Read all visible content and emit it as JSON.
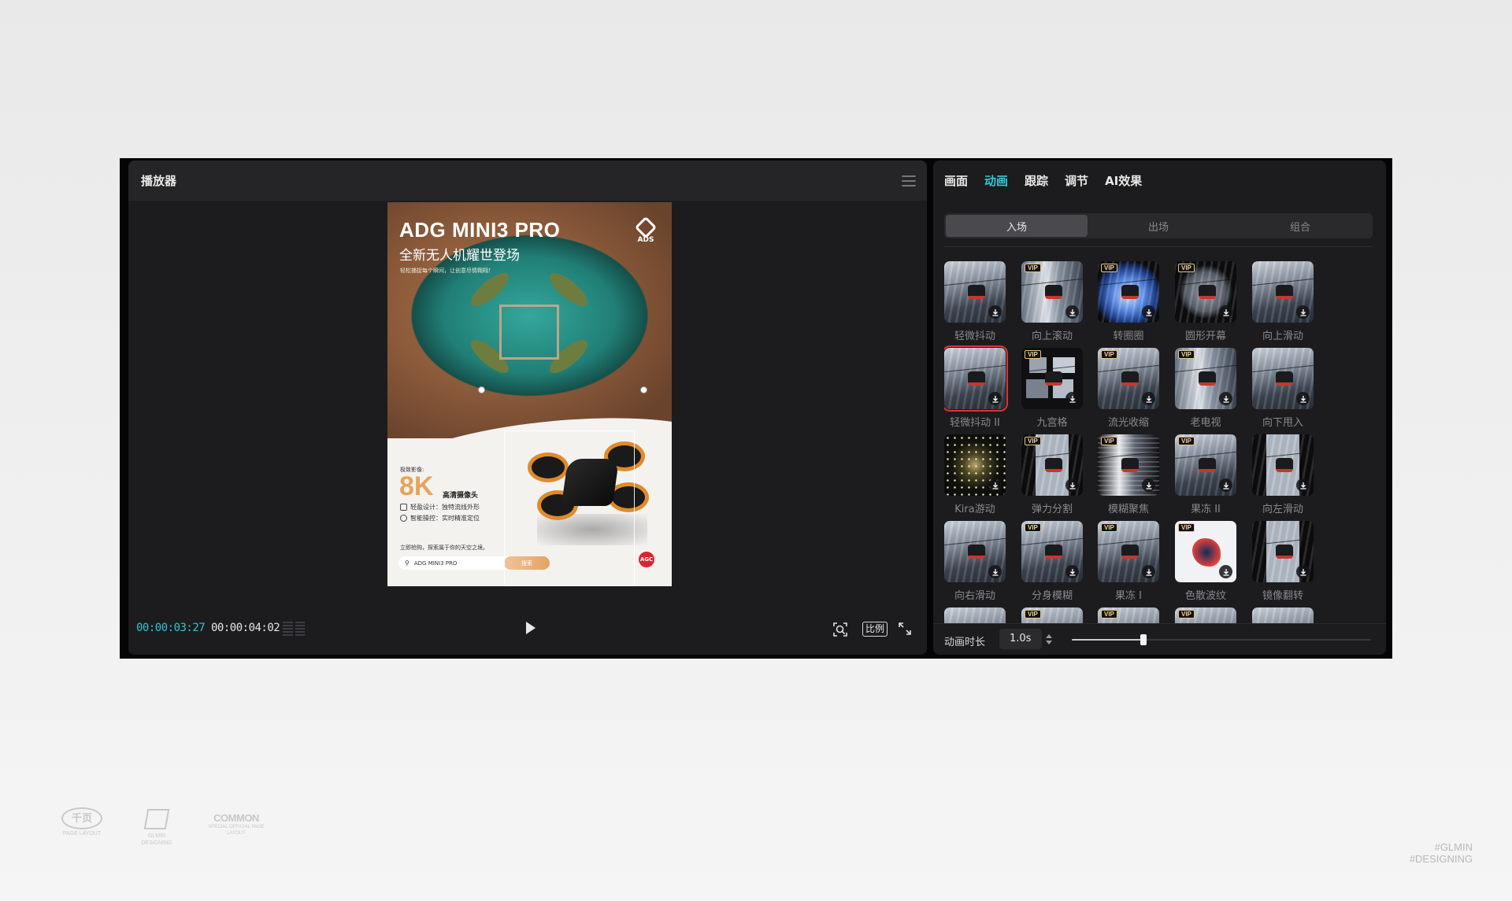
{
  "player": {
    "title": "播放器",
    "time_current": "00:00:03:27",
    "time_total": "00:00:04:02",
    "ratio_label": "比例"
  },
  "poster": {
    "headline": "ADG MINI3 PRO",
    "subheadline": "全新无人机耀世登场",
    "tagline": "轻松捕捉每个瞬间，让创意尽情翱翔！",
    "logo": "ADS",
    "label_imaging": "极致影像:",
    "big": "8K",
    "camera": "高清摄像头",
    "feature_1": "轻盈设计：独特流线外形",
    "feature_2": "智能操控：实时精准定位",
    "cta": "立即抢购，探索属于你的天空之境。",
    "search_text": "ADG MINI3 PRO",
    "search_button": "搜索",
    "badge": "AGC"
  },
  "props": {
    "tabs": [
      "画面",
      "动画",
      "跟踪",
      "调节",
      "AI效果"
    ],
    "active_tab": "动画",
    "sub_tabs": [
      "入场",
      "出场",
      "组合"
    ],
    "active_sub_tab": "入场",
    "items": [
      {
        "label": "轻微抖动",
        "vip": false,
        "style": "snow"
      },
      {
        "label": "向上滚动",
        "vip": true,
        "style": "blur"
      },
      {
        "label": "转圈圈",
        "vip": true,
        "style": "blue"
      },
      {
        "label": "圆形开幕",
        "vip": true,
        "style": "circle"
      },
      {
        "label": "向上滑动",
        "vip": false,
        "style": "snow"
      },
      {
        "label": "轻微抖动 II",
        "vip": false,
        "style": "snow",
        "selected": true
      },
      {
        "label": "九宫格",
        "vip": true,
        "style": "nine"
      },
      {
        "label": "流光收缩",
        "vip": true,
        "style": "snow"
      },
      {
        "label": "老电视",
        "vip": true,
        "style": "blur"
      },
      {
        "label": "向下甩入",
        "vip": false,
        "style": "snow"
      },
      {
        "label": "Kira游动",
        "vip": false,
        "style": "space"
      },
      {
        "label": "弹力分割",
        "vip": true,
        "style": "half"
      },
      {
        "label": "模糊聚焦",
        "vip": true,
        "style": "zoom"
      },
      {
        "label": "果冻 II",
        "vip": true,
        "style": "snow"
      },
      {
        "label": "向左滑动",
        "vip": false,
        "style": "half"
      },
      {
        "label": "向右滑动",
        "vip": false,
        "style": "snow"
      },
      {
        "label": "分身模糊",
        "vip": true,
        "style": "snow"
      },
      {
        "label": "果冻 I",
        "vip": true,
        "style": "snow"
      },
      {
        "label": "色散波纹",
        "vip": true,
        "style": "color"
      },
      {
        "label": "镜像翻转",
        "vip": false,
        "style": "half"
      },
      {
        "label": "",
        "vip": false,
        "style": "snow"
      },
      {
        "label": "",
        "vip": true,
        "style": "snow"
      },
      {
        "label": "",
        "vip": true,
        "style": "snow"
      },
      {
        "label": "",
        "vip": true,
        "style": "snow"
      },
      {
        "label": "",
        "vip": false,
        "style": "snow"
      }
    ],
    "vip_text": "VIP",
    "duration_label": "动画时长",
    "duration_value": "1.0s",
    "duration_fraction": 0.24
  },
  "watermarks": {
    "logo1": "千页",
    "logo1_sub": "PAGE LAYOUT",
    "logo2_sub": "GLMIN DESIGNING",
    "logo3": "COMMON",
    "logo3_sub": "SPECIAL OFFICIAL PAGE LAYOUT",
    "right_line1": "#GLMIN",
    "right_line2": "#DESIGNING"
  }
}
